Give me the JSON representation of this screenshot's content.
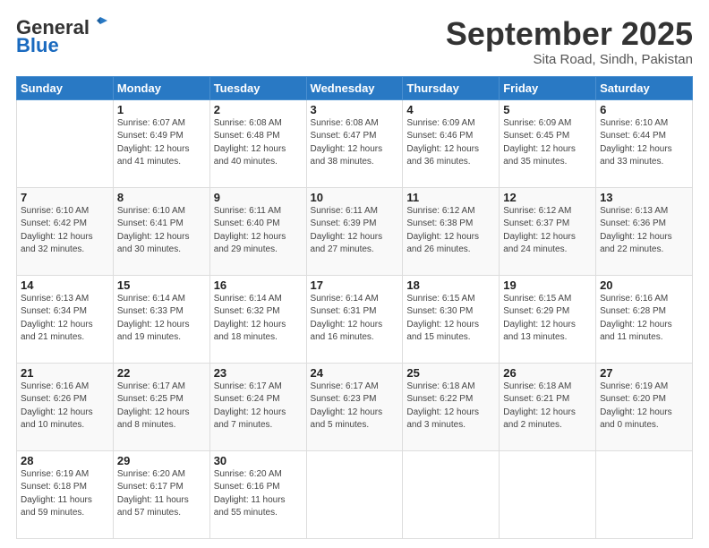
{
  "logo": {
    "general": "General",
    "blue": "Blue"
  },
  "header": {
    "month": "September 2025",
    "location": "Sita Road, Sindh, Pakistan"
  },
  "weekdays": [
    "Sunday",
    "Monday",
    "Tuesday",
    "Wednesday",
    "Thursday",
    "Friday",
    "Saturday"
  ],
  "weeks": [
    [
      {
        "day": "",
        "info": ""
      },
      {
        "day": "1",
        "info": "Sunrise: 6:07 AM\nSunset: 6:49 PM\nDaylight: 12 hours\nand 41 minutes."
      },
      {
        "day": "2",
        "info": "Sunrise: 6:08 AM\nSunset: 6:48 PM\nDaylight: 12 hours\nand 40 minutes."
      },
      {
        "day": "3",
        "info": "Sunrise: 6:08 AM\nSunset: 6:47 PM\nDaylight: 12 hours\nand 38 minutes."
      },
      {
        "day": "4",
        "info": "Sunrise: 6:09 AM\nSunset: 6:46 PM\nDaylight: 12 hours\nand 36 minutes."
      },
      {
        "day": "5",
        "info": "Sunrise: 6:09 AM\nSunset: 6:45 PM\nDaylight: 12 hours\nand 35 minutes."
      },
      {
        "day": "6",
        "info": "Sunrise: 6:10 AM\nSunset: 6:44 PM\nDaylight: 12 hours\nand 33 minutes."
      }
    ],
    [
      {
        "day": "7",
        "info": "Sunrise: 6:10 AM\nSunset: 6:42 PM\nDaylight: 12 hours\nand 32 minutes."
      },
      {
        "day": "8",
        "info": "Sunrise: 6:10 AM\nSunset: 6:41 PM\nDaylight: 12 hours\nand 30 minutes."
      },
      {
        "day": "9",
        "info": "Sunrise: 6:11 AM\nSunset: 6:40 PM\nDaylight: 12 hours\nand 29 minutes."
      },
      {
        "day": "10",
        "info": "Sunrise: 6:11 AM\nSunset: 6:39 PM\nDaylight: 12 hours\nand 27 minutes."
      },
      {
        "day": "11",
        "info": "Sunrise: 6:12 AM\nSunset: 6:38 PM\nDaylight: 12 hours\nand 26 minutes."
      },
      {
        "day": "12",
        "info": "Sunrise: 6:12 AM\nSunset: 6:37 PM\nDaylight: 12 hours\nand 24 minutes."
      },
      {
        "day": "13",
        "info": "Sunrise: 6:13 AM\nSunset: 6:36 PM\nDaylight: 12 hours\nand 22 minutes."
      }
    ],
    [
      {
        "day": "14",
        "info": "Sunrise: 6:13 AM\nSunset: 6:34 PM\nDaylight: 12 hours\nand 21 minutes."
      },
      {
        "day": "15",
        "info": "Sunrise: 6:14 AM\nSunset: 6:33 PM\nDaylight: 12 hours\nand 19 minutes."
      },
      {
        "day": "16",
        "info": "Sunrise: 6:14 AM\nSunset: 6:32 PM\nDaylight: 12 hours\nand 18 minutes."
      },
      {
        "day": "17",
        "info": "Sunrise: 6:14 AM\nSunset: 6:31 PM\nDaylight: 12 hours\nand 16 minutes."
      },
      {
        "day": "18",
        "info": "Sunrise: 6:15 AM\nSunset: 6:30 PM\nDaylight: 12 hours\nand 15 minutes."
      },
      {
        "day": "19",
        "info": "Sunrise: 6:15 AM\nSunset: 6:29 PM\nDaylight: 12 hours\nand 13 minutes."
      },
      {
        "day": "20",
        "info": "Sunrise: 6:16 AM\nSunset: 6:28 PM\nDaylight: 12 hours\nand 11 minutes."
      }
    ],
    [
      {
        "day": "21",
        "info": "Sunrise: 6:16 AM\nSunset: 6:26 PM\nDaylight: 12 hours\nand 10 minutes."
      },
      {
        "day": "22",
        "info": "Sunrise: 6:17 AM\nSunset: 6:25 PM\nDaylight: 12 hours\nand 8 minutes."
      },
      {
        "day": "23",
        "info": "Sunrise: 6:17 AM\nSunset: 6:24 PM\nDaylight: 12 hours\nand 7 minutes."
      },
      {
        "day": "24",
        "info": "Sunrise: 6:17 AM\nSunset: 6:23 PM\nDaylight: 12 hours\nand 5 minutes."
      },
      {
        "day": "25",
        "info": "Sunrise: 6:18 AM\nSunset: 6:22 PM\nDaylight: 12 hours\nand 3 minutes."
      },
      {
        "day": "26",
        "info": "Sunrise: 6:18 AM\nSunset: 6:21 PM\nDaylight: 12 hours\nand 2 minutes."
      },
      {
        "day": "27",
        "info": "Sunrise: 6:19 AM\nSunset: 6:20 PM\nDaylight: 12 hours\nand 0 minutes."
      }
    ],
    [
      {
        "day": "28",
        "info": "Sunrise: 6:19 AM\nSunset: 6:18 PM\nDaylight: 11 hours\nand 59 minutes."
      },
      {
        "day": "29",
        "info": "Sunrise: 6:20 AM\nSunset: 6:17 PM\nDaylight: 11 hours\nand 57 minutes."
      },
      {
        "day": "30",
        "info": "Sunrise: 6:20 AM\nSunset: 6:16 PM\nDaylight: 11 hours\nand 55 minutes."
      },
      {
        "day": "",
        "info": ""
      },
      {
        "day": "",
        "info": ""
      },
      {
        "day": "",
        "info": ""
      },
      {
        "day": "",
        "info": ""
      }
    ]
  ]
}
